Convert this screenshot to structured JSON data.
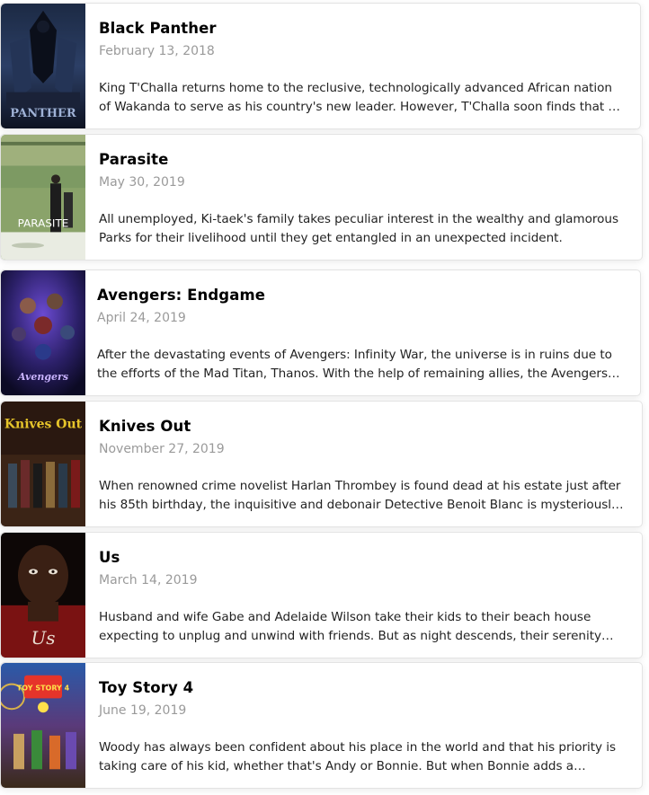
{
  "movies": [
    {
      "title": "Black Panther",
      "date": "February 13, 2018",
      "overview": "King T'Challa returns home to the reclusive, technologically advanced African nation of Wakanda to serve as his country's new leader. However, T'Challa soon finds that he is challenged for the throne from factions within his own country.",
      "poster_text": "PANTHER",
      "poster_icon": "black-panther-poster"
    },
    {
      "title": "Parasite",
      "date": "May 30, 2019",
      "overview": "All unemployed, Ki-taek's family takes peculiar interest in the wealthy and glamorous Parks for their livelihood until they get entangled in an unexpected incident.",
      "poster_text": "PARASITE",
      "poster_icon": "parasite-poster"
    },
    {
      "title": "Avengers: Endgame",
      "date": "April 24, 2019",
      "overview": "After the devastating events of Avengers: Infinity War, the universe is in ruins due to the efforts of the Mad Titan, Thanos. With the help of remaining allies, the Avengers must assemble once more in order to undo Thanos' actions.",
      "poster_text": "Avengers",
      "poster_icon": "avengers-endgame-poster"
    },
    {
      "title": "Knives Out",
      "date": "November 27, 2019",
      "overview": "When renowned crime novelist Harlan Thrombey is found dead at his estate just after his 85th birthday, the inquisitive and debonair Detective Benoit Blanc is mysteriously enlisted to investigate.",
      "poster_text": "Knives Out",
      "poster_icon": "knives-out-poster"
    },
    {
      "title": "Us",
      "date": "March 14, 2019",
      "overview": "Husband and wife Gabe and Adelaide Wilson take their kids to their beach house expecting to unplug and unwind with friends. But as night descends, their serenity turns to tension and chaos.",
      "poster_text": "Us",
      "poster_icon": "us-poster"
    },
    {
      "title": "Toy Story 4",
      "date": "June 19, 2019",
      "overview": "Woody has always been confident about his place in the world and that his priority is taking care of his kid, whether that's Andy or Bonnie. But when Bonnie adds a reluctant new toy called Forky to her room, a road trip adventure alongside old and new friends will show Woody how big the world can be for a toy.",
      "poster_text": "TOY STORY 4",
      "poster_icon": "toy-story-4-poster"
    }
  ],
  "colors": {
    "card_bg": "#ffffff",
    "card_border": "#e3e3e3",
    "title": "#000000",
    "date": "#9a9a9a",
    "overview": "#222222"
  }
}
